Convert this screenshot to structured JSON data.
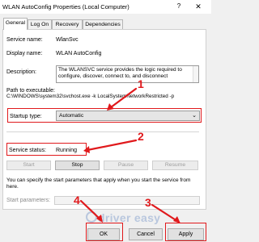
{
  "window": {
    "title": "WLAN AutoConfig Properties (Local Computer)",
    "help_glyph": "?",
    "close_glyph": "✕"
  },
  "tabs": [
    {
      "label": "General",
      "active": true
    },
    {
      "label": "Log On",
      "active": false
    },
    {
      "label": "Recovery",
      "active": false
    },
    {
      "label": "Dependencies",
      "active": false
    }
  ],
  "general": {
    "service_name_label": "Service name:",
    "service_name": "WlanSvc",
    "display_name_label": "Display name:",
    "display_name": "WLAN AutoConfig",
    "description_label": "Description:",
    "description": "The WLANSVC service provides the logic required to configure, discover, connect to, and disconnect",
    "path_label": "Path to executable:",
    "path": "C:\\WINDOWS\\system32\\svchost.exe -k LocalSystemNetworkRestricted -p",
    "startup_type_label": "Startup type:",
    "startup_type": "Automatic",
    "service_status_label": "Service status:",
    "service_status": "Running",
    "start_label": "Start",
    "stop_label": "Stop",
    "pause_label": "Pause",
    "resume_label": "Resume",
    "info_text": "You can specify the start parameters that apply when you start the service from here.",
    "start_params_label": "Start parameters:",
    "start_params_value": ""
  },
  "footer": {
    "ok_label": "OK",
    "cancel_label": "Cancel",
    "apply_label": "Apply"
  },
  "annotations": {
    "step1": "1",
    "step2": "2",
    "step3": "3",
    "step4": "4",
    "color": "#e0191c"
  },
  "watermark": {
    "text": "driver easy"
  }
}
